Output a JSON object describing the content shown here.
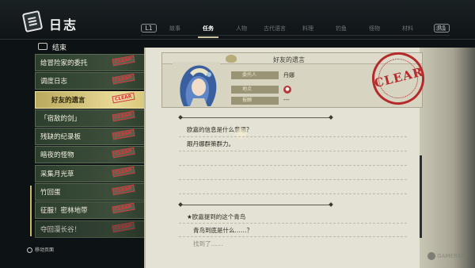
{
  "header": {
    "title": "日志"
  },
  "nav": {
    "left_button": "L1",
    "right_button": "R1",
    "tabs": [
      {
        "label": "故事",
        "active": false
      },
      {
        "label": "任务",
        "active": true
      },
      {
        "label": "人物",
        "active": false
      },
      {
        "label": "古代语言",
        "active": false
      },
      {
        "label": "料理",
        "active": false
      },
      {
        "label": "钓鱼",
        "active": false
      },
      {
        "label": "怪物",
        "active": false
      },
      {
        "label": "材料",
        "active": false
      },
      {
        "label": "装备",
        "active": false
      }
    ]
  },
  "quest_list": {
    "header": "结束",
    "items": [
      {
        "label": "给冒险家的委托",
        "stamp": "CLEAR",
        "selected": false
      },
      {
        "label": "调度日志",
        "stamp": "CLEAR",
        "selected": false
      },
      {
        "label": "好友的遗言",
        "stamp": "CLEAR",
        "selected": true
      },
      {
        "label": "「宿敌的剑」",
        "stamp": "CLEAR",
        "selected": false
      },
      {
        "label": "残缺的纪录板",
        "stamp": "CLEAR",
        "selected": false
      },
      {
        "label": "暗夜的怪物",
        "stamp": "CLEAR",
        "selected": false
      },
      {
        "label": "采集月光草",
        "stamp": "CLEAR",
        "selected": false
      },
      {
        "label": "竹回蛋",
        "stamp": "CLEAR",
        "selected": false
      },
      {
        "label": "征服！密林地带",
        "stamp": "CLEAR",
        "selected": false
      },
      {
        "label": "夺回漫长谷！",
        "stamp": "CLEAR",
        "selected": false
      }
    ]
  },
  "footer_hint": "移动页面",
  "detail": {
    "title": "好友的遗言",
    "rows": [
      {
        "label": "委托人",
        "value": "丹娜"
      },
      {
        "label": "地点",
        "value": ""
      },
      {
        "label": "报酬",
        "value": "---"
      }
    ],
    "stamp_text": "CLEAR",
    "entries": [
      "欧嘉的信息是什么意思？",
      "跟丹娜群策群力。",
      "★欧嘉提到的这个青鸟",
      "青鸟到底是什么……？",
      "找到了……"
    ]
  },
  "watermark": "GAMERSKY"
}
